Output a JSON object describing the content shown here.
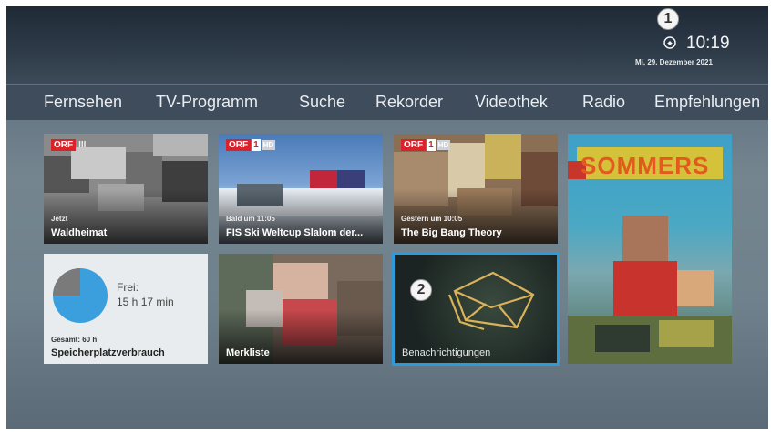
{
  "annotations": {
    "clock_marker": "1",
    "notification_marker": "2"
  },
  "status": {
    "time": "10:19",
    "date": "Mi, 29. Dezember 2021",
    "notification_icon": "notification-bell-icon"
  },
  "nav": {
    "items": [
      "Fernsehen",
      "TV-Programm",
      "Suche",
      "Rekorder",
      "Videothek",
      "Radio",
      "Empfehlungen"
    ]
  },
  "tiles": {
    "waldheimat": {
      "channel": "ORF",
      "channel_num": "III",
      "sublabel": "Jetzt",
      "title": "Waldheimat"
    },
    "ski": {
      "channel": "ORF",
      "channel_num": "1",
      "hd": "HD",
      "sublabel": "Bald um 11:05",
      "title": "FIS Ski Weltcup Slalom der..."
    },
    "bigbang": {
      "channel": "ORF",
      "channel_num": "1",
      "hd": "HD",
      "sublabel": "Gestern um 10:05",
      "title": "The Big Bang Theory"
    },
    "storage": {
      "free_label": "Frei:",
      "free_value": "15 h 17 min",
      "total": "Gesamt: 60 h",
      "title": "Speicherplatzverbrauch",
      "used_fraction": 0.25,
      "colors": {
        "free": "#3a9fdc",
        "used": "#7a7a7a"
      }
    },
    "merkliste": {
      "title": "Merkliste"
    },
    "notifications": {
      "title": "Benachrichtigungen",
      "focus_color": "#2e9ad9"
    },
    "featured": {
      "title_art": "SOMMERS"
    }
  }
}
